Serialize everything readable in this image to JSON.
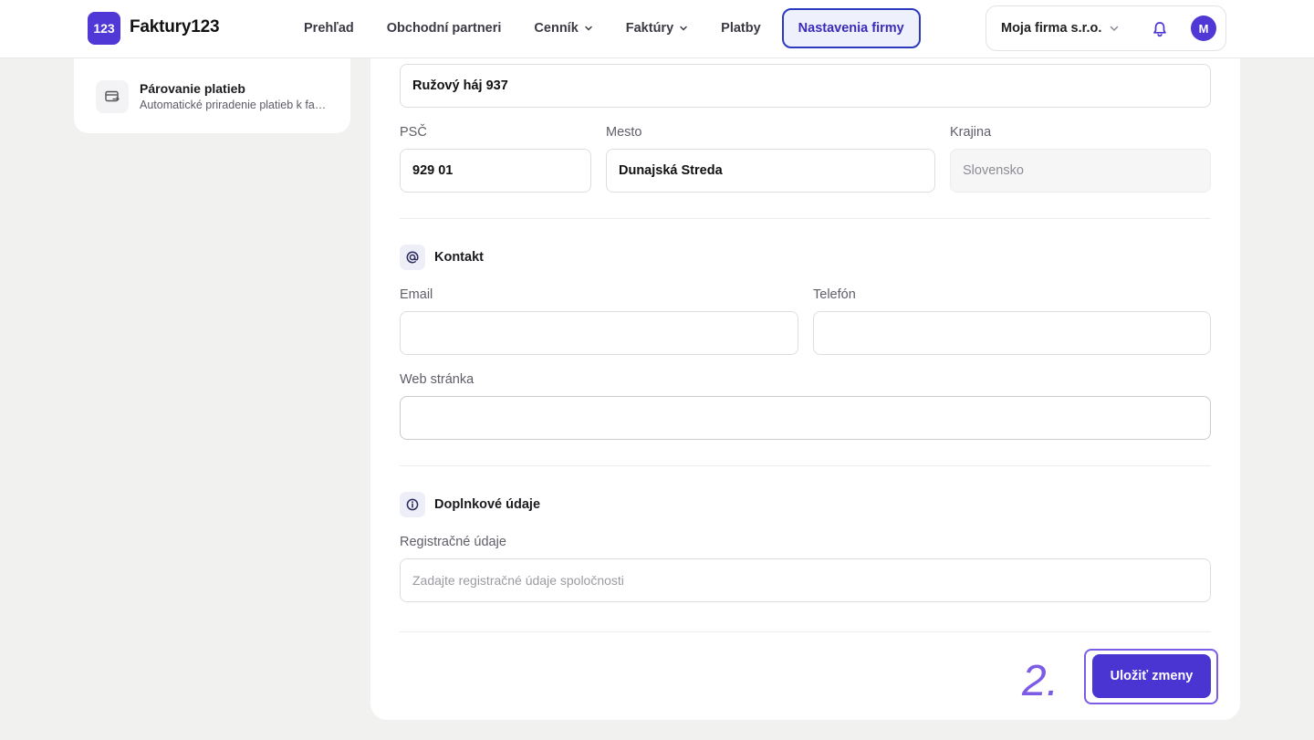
{
  "app": {
    "logo_badge": "123",
    "name": "Faktury123"
  },
  "nav": {
    "items": [
      {
        "label": "Prehľad",
        "dropdown": false,
        "active": false
      },
      {
        "label": "Obchodní partneri",
        "dropdown": false,
        "active": false
      },
      {
        "label": "Cenník",
        "dropdown": true,
        "active": false
      },
      {
        "label": "Faktúry",
        "dropdown": true,
        "active": false
      },
      {
        "label": "Platby",
        "dropdown": false,
        "active": false
      },
      {
        "label": "Nastavenia firmy",
        "dropdown": false,
        "active": true
      }
    ]
  },
  "account": {
    "firm_name": "Moja firma s.r.o.",
    "avatar_initial": "M",
    "icons": [
      "chevron-down-icon",
      "bell-icon"
    ]
  },
  "sidebar": {
    "item": {
      "title": "Párovanie platieb",
      "subtitle": "Automatické priradenie platieb k faktúram",
      "icon": "card-transfer-icon"
    }
  },
  "address": {
    "street_value": "Ružový háj 937",
    "psc_label": "PSČ",
    "psc_value": "929 01",
    "city_label": "Mesto",
    "city_value": "Dunajská Streda",
    "country_label": "Krajina",
    "country_value": "Slovensko"
  },
  "contact": {
    "section_title": "Kontakt",
    "section_icon": "at-sign-icon",
    "email_label": "Email",
    "email_value": "",
    "phone_label": "Telefón",
    "phone_value": "",
    "web_label": "Web stránka",
    "web_value": ""
  },
  "extra": {
    "section_title": "Doplnkové údaje",
    "section_icon": "info-icon",
    "registration_label": "Registračné údaje",
    "registration_placeholder": "Zadajte registračné údaje spoločnosti"
  },
  "actions": {
    "save_label": "Uložiť zmeny",
    "step_annotation": "2."
  },
  "colors": {
    "brand": "#4f38d6",
    "active_nav_border": "#2c3bbd",
    "annotation": "#7c5ce6"
  }
}
